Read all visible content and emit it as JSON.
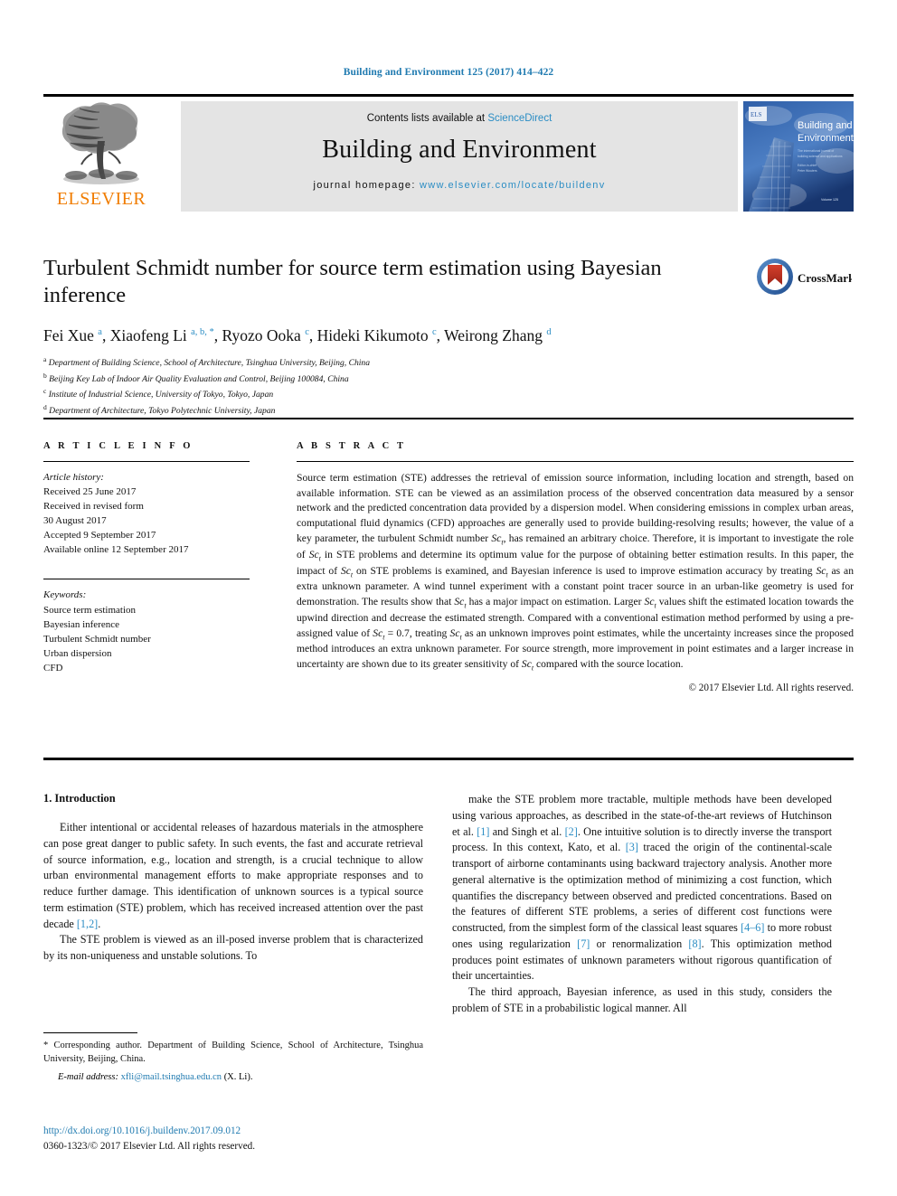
{
  "running_head": "Building and Environment 125 (2017) 414–422",
  "masthead": {
    "contents_prefix": "Contents lists available at ",
    "sciencedirect": "ScienceDirect",
    "journal_title": "Building and Environment",
    "homepage_label": "journal homepage: ",
    "homepage_url": "www.elsevier.com/locate/buildenv",
    "publisher": "ELSEVIER",
    "cover_title_line1": "Building and",
    "cover_title_line2": "Environment"
  },
  "article": {
    "title": "Turbulent Schmidt number for source term estimation using Bayesian inference",
    "crossmark_label": "CrossMark",
    "authors_html": "Fei Xue <sup>a</sup>, Xiaofeng Li <sup>a, b, *</sup>, Ryozo Ooka <sup>c</sup>, Hideki Kikumoto <sup>c</sup>, Weirong Zhang <sup>d</sup>",
    "affiliations": [
      {
        "marker": "a",
        "text": "Department of Building Science, School of Architecture, Tsinghua University, Beijing, China"
      },
      {
        "marker": "b",
        "text": "Beijing Key Lab of Indoor Air Quality Evaluation and Control, Beijing 100084, China"
      },
      {
        "marker": "c",
        "text": "Institute of Industrial Science, University of Tokyo, Tokyo, Japan"
      },
      {
        "marker": "d",
        "text": "Department of Architecture, Tokyo Polytechnic University, Japan"
      }
    ]
  },
  "article_info": {
    "heading": "A R T I C L E  I N F O",
    "history_label": "Article history:",
    "history": [
      "Received 25 June 2017",
      "Received in revised form",
      "30 August 2017",
      "Accepted 9 September 2017",
      "Available online 12 September 2017"
    ],
    "keywords_label": "Keywords:",
    "keywords": [
      "Source term estimation",
      "Bayesian inference",
      "Turbulent Schmidt number",
      "Urban dispersion",
      "CFD"
    ]
  },
  "abstract": {
    "heading": "A B S T R A C T",
    "body_html": "Source term estimation (STE) addresses the retrieval of emission source information, including location and strength, based on available information. STE can be viewed as an assimilation process of the observed concentration data measured by a sensor network and the predicted concentration data provided by a dispersion model. When considering emissions in complex urban areas, computational fluid dynamics (CFD) approaches are generally used to provide building-resolving results; however, the value of a key parameter, the turbulent Schmidt number <i>Sc<sub>t</sub></i>, has remained an arbitrary choice. Therefore, it is important to investigate the role of <i>Sc<sub>t</sub></i> in STE problems and determine its optimum value for the purpose of obtaining better estimation results. In this paper, the impact of <i>Sc<sub>t</sub></i> on STE problems is examined, and Bayesian inference is used to improve estimation accuracy by treating <i>Sc<sub>t</sub></i> as an extra unknown parameter. A wind tunnel experiment with a constant point tracer source in an urban-like geometry is used for demonstration. The results show that <i>Sc<sub>t</sub></i> has a major impact on estimation. Larger <i>Sc<sub>t</sub></i> values shift the estimated location towards the upwind direction and decrease the estimated strength. Compared with a conventional estimation method performed by using a pre-assigned value of <i>Sc<sub>t</sub></i> = 0.7, treating <i>Sc<sub>t</sub></i> as an unknown improves point estimates, while the uncertainty increases since the proposed method introduces an extra unknown parameter. For source strength, more improvement in point estimates and a larger increase in uncertainty are shown due to its greater sensitivity of <i>Sc<sub>t</sub></i> compared with the source location.",
    "copyright": "© 2017 Elsevier Ltd. All rights reserved."
  },
  "introduction": {
    "heading": "1.  Introduction",
    "left_paragraphs_html": [
      "Either intentional or accidental releases of hazardous materials in the atmosphere can pose great danger to public safety. In such events, the fast and accurate retrieval of source information, e.g., location and strength, is a crucial technique to allow urban environmental management efforts to make appropriate responses and to reduce further damage. This identification of unknown sources is a typical source term estimation (STE) problem, which has received increased attention over the past decade <span class=\"ref\">[1,2]</span>.",
      "The STE problem is viewed as an ill-posed inverse problem that is characterized by its non-uniqueness and unstable solutions. To"
    ],
    "right_paragraphs_html": [
      "make the STE problem more tractable, multiple methods have been developed using various approaches, as described in the state-of-the-art reviews of Hutchinson et al. <span class=\"ref\">[1]</span> and Singh et al. <span class=\"ref\">[2]</span>. One intuitive solution is to directly inverse the transport process. In this context, Kato, et al. <span class=\"ref\">[3]</span> traced the origin of the continental-scale transport of airborne contaminants using backward trajectory analysis. Another more general alternative is the optimization method of minimizing a cost function, which quantifies the discrepancy between observed and predicted concentrations. Based on the features of different STE problems, a series of different cost functions were constructed, from the simplest form of the classical least squares <span class=\"ref\">[4–6]</span> to more robust ones using regularization <span class=\"ref\">[7]</span> or renormalization <span class=\"ref\">[8]</span>. This optimization method produces point estimates of unknown parameters without rigorous quantification of their uncertainties.",
      "The third approach, Bayesian inference, as used in this study, considers the problem of STE in a probabilistic logical manner. All"
    ]
  },
  "footnote": {
    "corresponding_html": "* Corresponding author. Department of Building Science, School of Architecture, Tsinghua University, Beijing, China.",
    "email_label": "E-mail address:",
    "email": "xfli@mail.tsinghua.edu.cn",
    "email_suffix": "(X. Li)."
  },
  "footer": {
    "doi": "http://dx.doi.org/10.1016/j.buildenv.2017.09.012",
    "issn": "0360-1323/© 2017 Elsevier Ltd. All rights reserved."
  },
  "colors": {
    "link_blue": "#2b8dc4",
    "header_blue": "#1f7ab0",
    "elsevier_orange": "#F07C00",
    "banner_gray": "#e4e4e4"
  }
}
